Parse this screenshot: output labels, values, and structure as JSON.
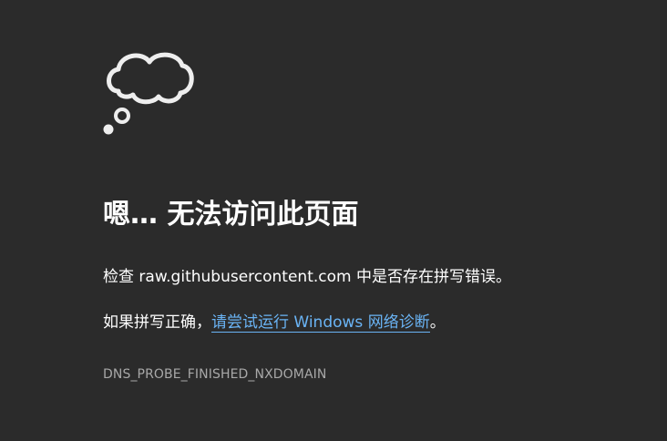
{
  "icon": "thought-bubble-icon",
  "title": "嗯… 无法访问此页面",
  "check_line": {
    "prefix": "检查 ",
    "domain": "raw.githubusercontent.com",
    "suffix": " 中是否存在拼写错误。"
  },
  "diagnose_line": {
    "prefix": "如果拼写正确，",
    "link_text": "请尝试运行 Windows 网络诊断",
    "suffix": "。"
  },
  "error_code": "DNS_PROBE_FINISHED_NXDOMAIN",
  "colors": {
    "background": "#2b2b2b",
    "text": "#ffffff",
    "link": "#6ab4f5",
    "error_code": "#a8a8a8"
  }
}
